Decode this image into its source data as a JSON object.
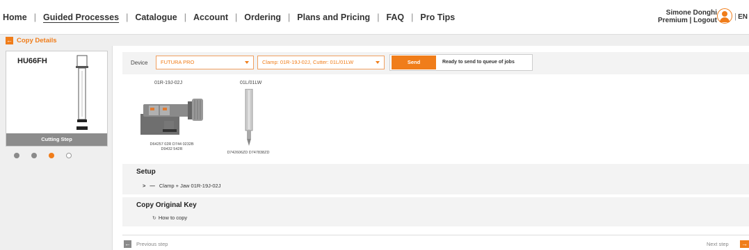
{
  "nav": {
    "items": [
      {
        "label": "Home"
      },
      {
        "label": "Guided Processes",
        "active": true
      },
      {
        "label": "Catalogue"
      },
      {
        "label": "Account"
      },
      {
        "label": "Ordering"
      },
      {
        "label": "Plans and Pricing"
      },
      {
        "label": "FAQ"
      },
      {
        "label": "Pro Tips"
      }
    ],
    "separator": "|"
  },
  "user": {
    "name": "Simone Donghi",
    "plan": "Premium",
    "plan_separator": " | ",
    "logout": "Logout",
    "avatar_icon": "user-avatar-icon",
    "lang_separator": "|",
    "language": "EN"
  },
  "breadcrumb": {
    "back_icon": "arrow-left-icon",
    "title": "Copy Details"
  },
  "key_card": {
    "code": "HU66FH",
    "step_label": "Cutting Step",
    "steps": [
      {
        "state": "done"
      },
      {
        "state": "done"
      },
      {
        "state": "current"
      },
      {
        "state": "todo"
      }
    ]
  },
  "device_bar": {
    "device_label": "Device",
    "device_value": "FUTURA PRO",
    "clamp_cutter_value": "Clamp: 01R-19J-02J, Cutter: 01L/01LW",
    "send_label": "Send",
    "send_status": "Ready to send to queue of jobs"
  },
  "tools": [
    {
      "title": "01R-19J-02J",
      "codes": [
        "D64257 02R D744 0232B",
        "D9432 542R"
      ]
    },
    {
      "title": "01L/01LW",
      "codes": [
        "D742606ZD D747838ZD"
      ]
    }
  ],
  "setup": {
    "heading": "Setup",
    "chevron": ">",
    "dash": "—",
    "line": "Clamp + Jaw 01R-19J-02J"
  },
  "copy_key": {
    "heading": "Copy Original Key",
    "icon": "3d-view-icon",
    "link": "How to copy"
  },
  "footer": {
    "prev_label": "Previous step",
    "next_label": "Next step"
  },
  "colors": {
    "accent": "#f07d1a",
    "panel": "#efefef",
    "step_bar": "#8c8c8c"
  }
}
